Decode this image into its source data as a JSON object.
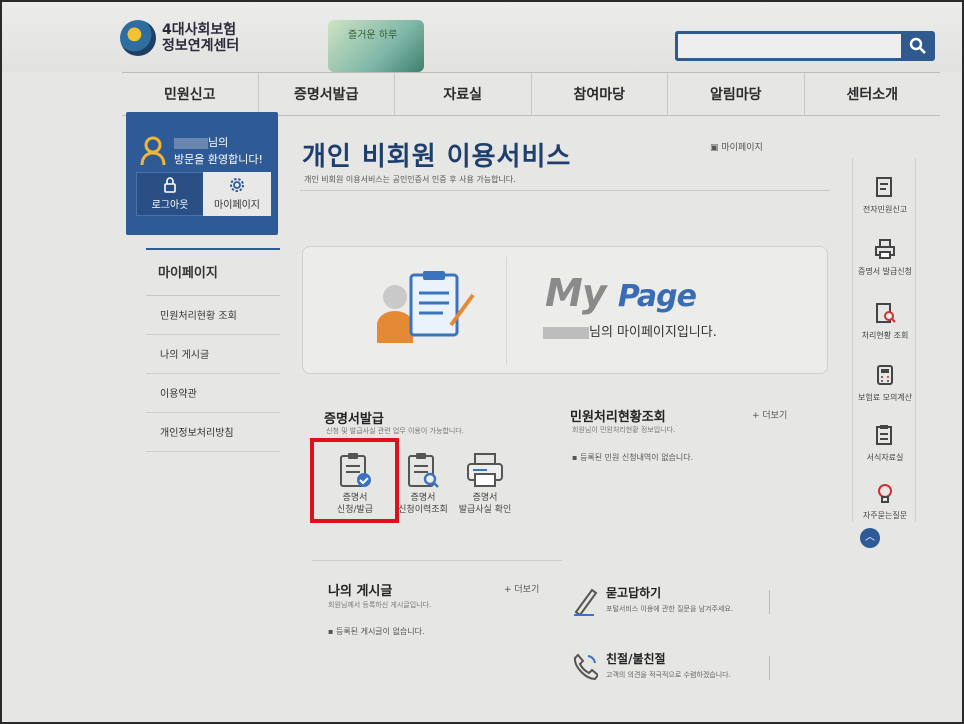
{
  "header": {
    "logo_line1": "4대사회보험",
    "logo_line2": "정보연계센터",
    "banner_text": "즐거운 하루",
    "search_placeholder": ""
  },
  "nav": [
    "민원신고",
    "증명서발급",
    "자료실",
    "참여마당",
    "알림마당",
    "센터소개"
  ],
  "user": {
    "greeting_suffix": "님의",
    "welcome": "방문을 환영합니다!",
    "logout": "로그아웃",
    "mypage": "마이페이지"
  },
  "left_menu": {
    "title": "마이페이지",
    "items": [
      "민원처리현황 조회",
      "나의 게시글",
      "이용약관",
      "개인정보처리방침"
    ]
  },
  "main": {
    "title": "개인 비회원 이용서비스",
    "subtitle": "개인 비회원 이용서비스는 공인인증서 인증 후 사용 가능합니다.",
    "breadcrumb": "마이페이지",
    "mypage_logo_my": "My",
    "mypage_logo_page": "Page",
    "mypage_welcome": "님의 마이페이지입니다."
  },
  "cert_section": {
    "title": "증명서발급",
    "desc": "신청 및 발급사실 관련 업무 이용이 가능합니다.",
    "services": [
      {
        "line1": "증명서",
        "line2": "신청/발급"
      },
      {
        "line1": "증명서",
        "line2": "신청이력조회"
      },
      {
        "line1": "증명서",
        "line2": "발급사실 확인"
      }
    ]
  },
  "status_section": {
    "title": "민원처리현황조회",
    "desc": "회원님이 민원처리현황 정보입니다.",
    "more": "더보기",
    "empty": "등록된 민원 신청내역이 없습니다."
  },
  "posts_section": {
    "title": "나의 게시글",
    "desc": "회원님께서 등록하신 게시글입니다.",
    "more": "더보기",
    "empty": "등록된 게시글이 없습니다."
  },
  "qa": {
    "title": "묻고답하기",
    "desc": "포털서비스 이용에 관한 질문을 남겨주세요."
  },
  "kind": {
    "title": "친절/불친절",
    "desc": "고객의 의견을 적극적으로 수렴하겠습니다."
  },
  "quick_menu": [
    "전자민원신고",
    "증명서 발급신청",
    "처리현황 조회",
    "보험료 모의계산",
    "서식자료실",
    "자주묻는질문"
  ],
  "colors": {
    "brand": "#2e5a96",
    "highlight": "#e0101a"
  }
}
